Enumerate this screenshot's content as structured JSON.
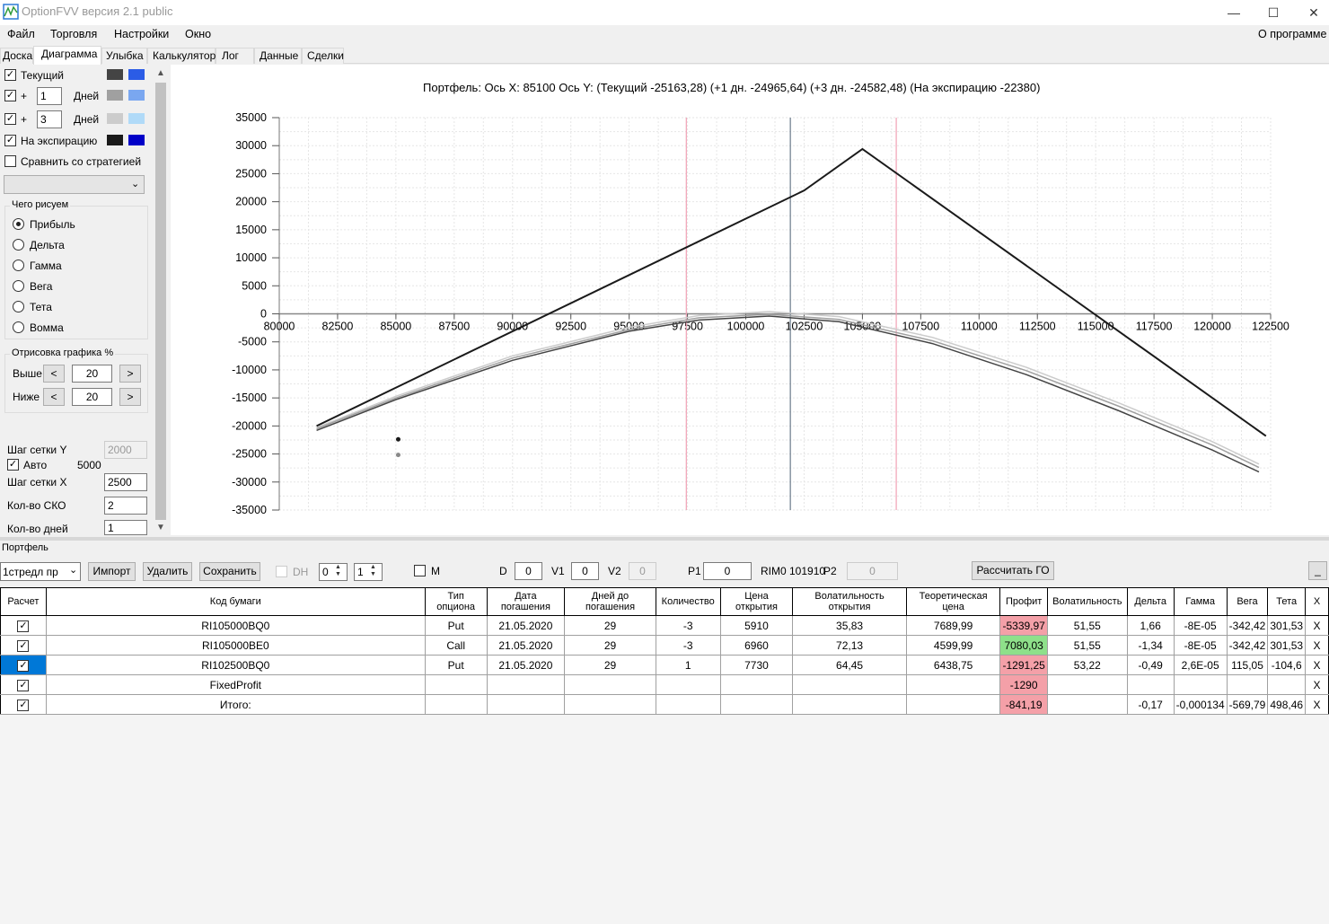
{
  "window": {
    "title": "OptionFVV версия 2.1 public"
  },
  "menu": {
    "file": "Файл",
    "trade": "Торговля",
    "settings": "Настройки",
    "window": "Окно",
    "about": "О программе"
  },
  "tabs": [
    "Доска",
    "Диаграмма",
    "Улыбка",
    "Калькулятор",
    "Лог",
    "Данные",
    "Сделки"
  ],
  "active_tab": "Диаграмма",
  "left_panel": {
    "current_label": "Текущий",
    "plus_label": "+",
    "days_label": "Дней",
    "plus1_value": "1",
    "plus2_value": "3",
    "expiration_label": "На экспирацию",
    "compare_label": "Сравнить со стратегией",
    "what_group": "Чего рисуем",
    "radios": [
      "Прибыль",
      "Дельта",
      "Гамма",
      "Вега",
      "Тета",
      "Вомма"
    ],
    "render_group": "Отрисовка графика %",
    "above_label": "Выше",
    "above_value": "20",
    "below_label": "Ниже",
    "below_value": "20",
    "grid_y_label": "Шаг сетки Y",
    "grid_y_value": "2000",
    "auto_label": "Авто",
    "auto_value": "5000",
    "grid_x_label": "Шаг сетки X",
    "grid_x_value": "2500",
    "sko_label": "Кол-во СКО",
    "sko_value": "2",
    "days_count_label": "Кол-во дней",
    "days_count_value": "1",
    "btn_less": "<",
    "btn_more": ">",
    "colors": {
      "current": [
        "#444444",
        "#2b5ce6"
      ],
      "plus1": [
        "#a0a0a0",
        "#7aa7f0"
      ],
      "plus3": [
        "#cccccc",
        "#b0daf8"
      ],
      "expiration": [
        "#1a1a1a",
        "#0000c8"
      ]
    }
  },
  "chart_data": {
    "type": "line",
    "title": "Портфель: Ось X: 85100 Ось Y:  (Текущий -25163,28)  (+1 дн. -24965,64)  (+3 дн. -24582,48)  (На экспирацию -22380)",
    "xlim": [
      80000,
      122500
    ],
    "ylim": [
      -35000,
      35000
    ],
    "x_ticks": [
      "80000",
      "82500",
      "85000",
      "87500",
      "90000",
      "92500",
      "95000",
      "97500",
      "100000",
      "102500",
      "105000",
      "107500",
      "110000",
      "112500",
      "115000",
      "117500",
      "120000",
      "122500"
    ],
    "y_ticks": [
      "35000",
      "30000",
      "25000",
      "20000",
      "15000",
      "10000",
      "5000",
      "0",
      "-5000",
      "-10000",
      "-15000",
      "-20000",
      "-25000",
      "-30000",
      "-35000"
    ],
    "grid": true,
    "vlines": [
      {
        "x": 97450,
        "color": "#f0a0b4"
      },
      {
        "x": 101910,
        "color": "#6a7a8a"
      },
      {
        "x": 106450,
        "color": "#f0a0b4"
      }
    ],
    "series": [
      {
        "color": "#1a1a1a",
        "x": [
          81600,
          102500,
          105000,
          122300
        ],
        "y": [
          -20000,
          22000,
          29400,
          -21800
        ]
      },
      {
        "color": "#444444",
        "x": [
          81600,
          85000,
          90000,
          95000,
          98000,
          101000,
          104000,
          108000,
          112000,
          116000,
          120000,
          122000
        ],
        "y": [
          -20800,
          -15300,
          -8300,
          -3100,
          -1100,
          -400,
          -1400,
          -5300,
          -10800,
          -17300,
          -24300,
          -28200
        ]
      },
      {
        "color": "#a0a0a0",
        "x": [
          81600,
          85000,
          90000,
          95000,
          98000,
          101000,
          104000,
          108000,
          112000,
          116000,
          120000,
          122000
        ],
        "y": [
          -20500,
          -15000,
          -7900,
          -2800,
          -700,
          -100,
          -1000,
          -4800,
          -10100,
          -16500,
          -23400,
          -27400
        ]
      },
      {
        "color": "#cccccc",
        "x": [
          81600,
          85000,
          90000,
          95000,
          98000,
          101000,
          104000,
          108000,
          112000,
          116000,
          120000,
          122000
        ],
        "y": [
          -20300,
          -14700,
          -7500,
          -2400,
          -300,
          400,
          -500,
          -4200,
          -9500,
          -15900,
          -22800,
          -26800
        ]
      }
    ],
    "points": [
      {
        "x": 85100,
        "y": -22380,
        "color": "#1a1a1a"
      },
      {
        "x": 85100,
        "y": -25163,
        "color": "#888888"
      }
    ]
  },
  "portfolio": {
    "label": "Портфель",
    "strategy": "1стредл пр",
    "import": "Импорт",
    "delete": "Удалить",
    "save": "Сохранить",
    "dh": "DH",
    "spin1": "0",
    "spin2": "1",
    "m": "M",
    "d_label": "D",
    "d_value": "0",
    "v1_label": "V1",
    "v1_value": "0",
    "v2_label": "V2",
    "v2_value": "0",
    "p1_label": "P1",
    "p1_value": "0",
    "rim": "RIM0 101910",
    "p2_label": "P2",
    "p2_value": "0",
    "calc_go": "Рассчитать ГО",
    "collapse": "_"
  },
  "table": {
    "headers": [
      "Расчет",
      "Код бумаги",
      "Тип опциона",
      "Дата погашения",
      "Дней до погашения",
      "Количество",
      "Цена открытия",
      "Волатильность открытия",
      "Теоретическая цена",
      "Профит",
      "Волатильность",
      "Дельта",
      "Гамма",
      "Вега",
      "Тета",
      "X"
    ],
    "rows": [
      [
        "RI105000BQ0",
        "Put",
        "21.05.2020",
        "29",
        "-3",
        "5910",
        "35,83",
        "7689,99",
        "-5339,97",
        "51,55",
        "1,66",
        "-8E-05",
        "-342,42",
        "301,53",
        "X"
      ],
      [
        "RI105000BE0",
        "Call",
        "21.05.2020",
        "29",
        "-3",
        "6960",
        "72,13",
        "4599,99",
        "7080,03",
        "51,55",
        "-1,34",
        "-8E-05",
        "-342,42",
        "301,53",
        "X"
      ],
      [
        "RI102500BQ0",
        "Put",
        "21.05.2020",
        "29",
        "1",
        "7730",
        "64,45",
        "6438,75",
        "-1291,25",
        "53,22",
        "-0,49",
        "2,6E-05",
        "115,05",
        "-104,6",
        "X"
      ],
      [
        "FixedProfit",
        "",
        "",
        "",
        "",
        "",
        "",
        "",
        "-1290",
        "",
        "",
        "",
        "",
        "",
        "X"
      ],
      [
        "Итого:",
        "",
        "",
        "",
        "",
        "",
        "",
        "",
        "-841,19",
        "",
        "-0,17",
        "-0,000134",
        "-569,79",
        "498,46",
        "X"
      ]
    ],
    "profit_colors": [
      "#f4a0a8",
      "#8ee08a",
      "#f4a0a8",
      "#f4a0a8",
      "#f4a0a8"
    ],
    "check_mark": "✓"
  }
}
